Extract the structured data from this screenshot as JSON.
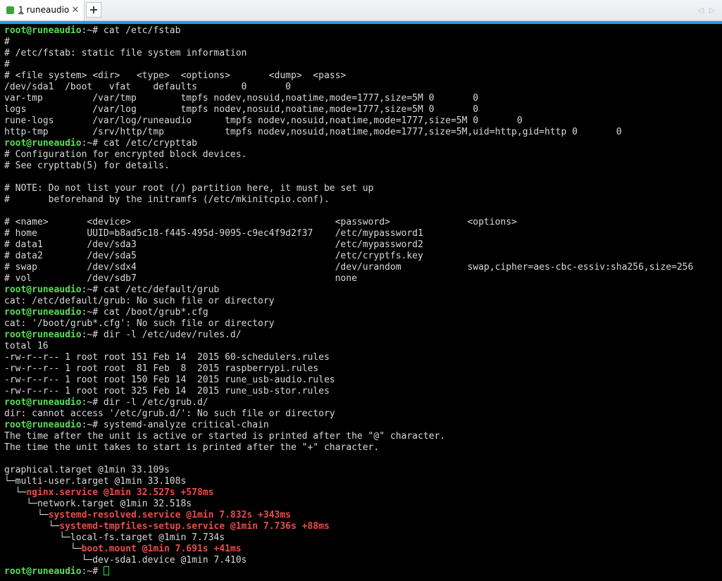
{
  "window": {
    "tab": {
      "number": "1",
      "name": "runeaudio",
      "close": "✕"
    },
    "new_tab": "+",
    "scroll_left": "◁",
    "scroll_right": "▷"
  },
  "colors": {
    "background": "#000000",
    "text": "#d8d8d8",
    "prompt_user": "#54e054",
    "highlight_red": "#ec4b4b",
    "accent_line": "#1fa0dd",
    "tab_status": "#3aa33a"
  },
  "terminal": {
    "prompt_user": "root@runeaudio",
    "prompt_suffix": ":~# ",
    "lines": [
      {
        "kind": "prompt",
        "text": "cat /etc/fstab"
      },
      {
        "text": "#"
      },
      {
        "text": "# /etc/fstab: static file system information"
      },
      {
        "text": "#"
      },
      {
        "text": "# <file system> <dir>   <type>  <options>       <dump>  <pass>"
      },
      {
        "text": "/dev/sda1  /boot   vfat    defaults        0       0"
      },
      {
        "text": "var-tmp         /var/tmp        tmpfs nodev,nosuid,noatime,mode=1777,size=5M 0       0"
      },
      {
        "text": "logs            /var/log        tmpfs nodev,nosuid,noatime,mode=1777,size=5M 0       0"
      },
      {
        "text": "rune-logs       /var/log/runeaudio      tmpfs nodev,nosuid,noatime,mode=1777,size=5M 0       0"
      },
      {
        "text": "http-tmp        /srv/http/tmp           tmpfs nodev,nosuid,noatime,mode=1777,size=5M,uid=http,gid=http 0       0"
      },
      {
        "kind": "prompt",
        "text": "cat /etc/crypttab"
      },
      {
        "text": "# Configuration for encrypted block devices."
      },
      {
        "text": "# See crypttab(5) for details."
      },
      {
        "text": ""
      },
      {
        "text": "# NOTE: Do not list your root (/) partition here, it must be set up"
      },
      {
        "text": "#       beforehand by the initramfs (/etc/mkinitcpio.conf)."
      },
      {
        "text": ""
      },
      {
        "text": "# <name>       <device>                                     <password>              <options>"
      },
      {
        "text": "# home         UUID=b8ad5c18-f445-495d-9095-c9ec4f9d2f37    /etc/mypassword1"
      },
      {
        "text": "# data1        /dev/sda3                                    /etc/mypassword2"
      },
      {
        "text": "# data2        /dev/sda5                                    /etc/cryptfs.key"
      },
      {
        "text": "# swap         /dev/sdx4                                    /dev/urandom            swap,cipher=aes-cbc-essiv:sha256,size=256"
      },
      {
        "text": "# vol          /dev/sdb7                                    none"
      },
      {
        "kind": "prompt",
        "text": "cat /etc/default/grub"
      },
      {
        "text": "cat: /etc/default/grub: No such file or directory"
      },
      {
        "kind": "prompt",
        "text": "cat /boot/grub*.cfg"
      },
      {
        "text": "cat: '/boot/grub*.cfg': No such file or directory"
      },
      {
        "kind": "prompt",
        "text": "dir -l /etc/udev/rules.d/"
      },
      {
        "text": "total 16"
      },
      {
        "text": "-rw-r--r-- 1 root root 151 Feb 14  2015 60-schedulers.rules"
      },
      {
        "text": "-rw-r--r-- 1 root root  81 Feb  8  2015 raspberrypi.rules"
      },
      {
        "text": "-rw-r--r-- 1 root root 150 Feb 14  2015 rune_usb-audio.rules"
      },
      {
        "text": "-rw-r--r-- 1 root root 325 Feb 14  2015 rune_usb-stor.rules"
      },
      {
        "kind": "prompt",
        "text": "dir -l /etc/grub.d/"
      },
      {
        "text": "dir: cannot access '/etc/grub.d/': No such file or directory"
      },
      {
        "kind": "prompt",
        "text": "systemd-analyze critical-chain"
      },
      {
        "text": "The time after the unit is active or started is printed after the \"@\" character."
      },
      {
        "text": "The time the unit takes to start is printed after the \"+\" character."
      },
      {
        "text": ""
      },
      {
        "text": "graphical.target @1min 33.109s"
      },
      {
        "text": "└─multi-user.target @1min 33.108s"
      },
      {
        "prefix": "  └─",
        "red": "nginx.service @1min 32.527s +578ms"
      },
      {
        "text": "    └─network.target @1min 32.518s"
      },
      {
        "prefix": "      └─",
        "red": "systemd-resolved.service @1min 7.832s +343ms"
      },
      {
        "prefix": "        └─",
        "red": "systemd-tmpfiles-setup.service @1min 7.736s +88ms"
      },
      {
        "text": "          └─local-fs.target @1min 7.734s"
      },
      {
        "prefix": "            └─",
        "red": "boot.mount @1min 7.691s +41ms"
      },
      {
        "text": "              └─dev-sda1.device @1min 7.410s"
      },
      {
        "kind": "prompt",
        "text": "",
        "cursor": true
      }
    ]
  }
}
